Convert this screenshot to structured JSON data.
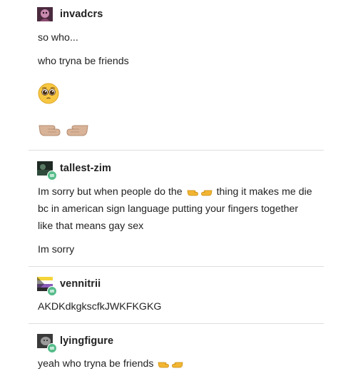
{
  "posts": [
    {
      "username": "invadcrs",
      "avatar_icon": "dark-pink-avatar-icon",
      "reblog": false,
      "lines": [
        "so who...",
        "who tryna be friends"
      ],
      "emoji": [
        "pleading-face-emoji",
        "pointing-fingers-emoji"
      ]
    },
    {
      "username": "tallest-zim",
      "avatar_icon": "dark-green-avatar-icon",
      "reblog": true,
      "lines": [
        "Im sorry but when people do the",
        "thing it makes me die",
        "bc in american sign language putting your fingers together",
        "like that means gay sex",
        "Im sorry"
      ]
    },
    {
      "username": "vennitrii",
      "avatar_icon": "flag-avatar-icon",
      "reblog": true,
      "lines": [
        "AKDKdkgkscfkJWKFKGKG"
      ]
    },
    {
      "username": "lyingfigure",
      "avatar_icon": "grey-face-avatar-icon",
      "reblog": true,
      "lines": [
        "yeah who tryna be friends"
      ]
    }
  ],
  "colors": {
    "divider": "#dddddd",
    "reblog_badge": "#56bc8a",
    "text": "#222222",
    "skin_tone_light": "#d8b398",
    "skin_tone_yellow": "#f2b632"
  }
}
